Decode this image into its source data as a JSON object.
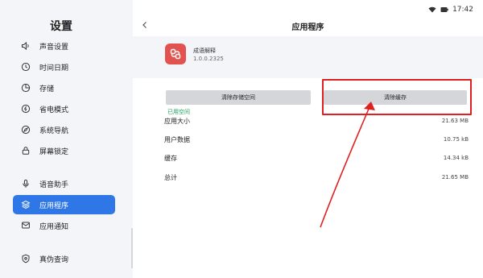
{
  "status": {
    "time": "17:42"
  },
  "sidebar": {
    "title": "设置",
    "items": [
      {
        "label": "声音设置",
        "icon": "speaker-icon"
      },
      {
        "label": "时间日期",
        "icon": "clock-icon"
      },
      {
        "label": "存储",
        "icon": "storage-icon"
      },
      {
        "label": "省电模式",
        "icon": "battery-icon"
      },
      {
        "label": "系统导航",
        "icon": "compass-icon"
      },
      {
        "label": "屏幕锁定",
        "icon": "lock-icon"
      },
      {
        "label": "语音助手",
        "icon": "microphone-icon"
      },
      {
        "label": "应用程序",
        "icon": "layers-icon",
        "active": true
      },
      {
        "label": "应用通知",
        "icon": "message-icon"
      },
      {
        "label": "真伪查询",
        "icon": "shield-icon"
      }
    ]
  },
  "main": {
    "title": "应用程序",
    "app": {
      "name": "成语解释",
      "version": "1.0.0.2325"
    },
    "buttons": {
      "clear_storage": "清除存储空间",
      "clear_cache": "清除缓存"
    },
    "used_space_label": "已用空间",
    "rows": [
      {
        "key": "应用大小",
        "value": "21.63 MB"
      },
      {
        "key": "用户数据",
        "value": "10.75 kB"
      },
      {
        "key": "缓存",
        "value": "14.34 kB"
      },
      {
        "key": "总计",
        "value": "21.65 MB"
      }
    ]
  },
  "colors": {
    "accent": "#2f77e6",
    "annotation": "#e02020",
    "used_label": "#22a35a",
    "app_icon": "#e2534f"
  }
}
